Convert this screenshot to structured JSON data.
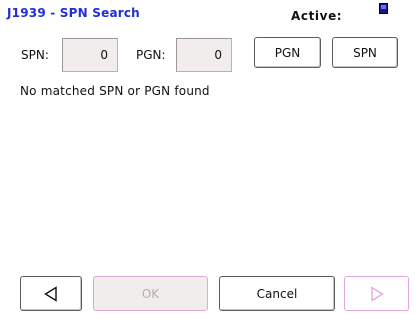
{
  "header": {
    "title": "J1939 - SPN Search",
    "active_label": "Active:",
    "status_icon": "battery-indicator-icon"
  },
  "search": {
    "spn_label": "SPN:",
    "spn_value": "0",
    "pgn_label": "PGN:",
    "pgn_value": "0"
  },
  "mode_buttons": {
    "pgn_label": "PGN",
    "spn_label": "SPN"
  },
  "results": {
    "message": "No matched SPN or PGN found"
  },
  "footer": {
    "back_icon": "triangle-left-icon",
    "ok_label": "OK",
    "cancel_label": "Cancel",
    "next_icon": "triangle-right-icon"
  },
  "colors": {
    "title": "#1f2fd6",
    "disabled_border": "#e0a7df",
    "field_bg": "#f1eded"
  }
}
